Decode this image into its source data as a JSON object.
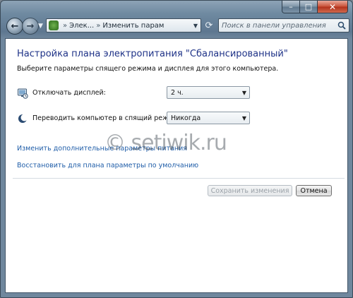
{
  "window": {
    "caption_minimize": "–",
    "caption_maximize": "□",
    "caption_close": "✕"
  },
  "navbar": {
    "back_icon": "arrow-left-icon",
    "forward_icon": "arrow-right-icon",
    "breadcrumb_1": "Элек...",
    "breadcrumb_2": "Изменить параметр...",
    "separator": "»",
    "search_placeholder": "Поиск в панели управления"
  },
  "main": {
    "title": "Настройка плана электропитания \"Сбалансированный\"",
    "subtitle": "Выберите параметры спящего режима и дисплея для этого компьютера.",
    "settings": [
      {
        "icon": "display-icon",
        "label": "Отключать дисплей:",
        "value": "2 ч."
      },
      {
        "icon": "sleep-moon-icon",
        "label": "Переводить компьютер в спящий режим:",
        "value": "Никогда"
      }
    ],
    "links": {
      "advanced": "Изменить дополнительные параметры питания",
      "restore": "Восстановить для плана параметры по умолчанию"
    },
    "buttons": {
      "save": "Сохранить изменения",
      "cancel": "Отмена"
    }
  },
  "watermark": "© setiwik.ru",
  "colors": {
    "title": "#1e3287",
    "link": "#1f5da8",
    "frame": "#6f8aa1"
  }
}
